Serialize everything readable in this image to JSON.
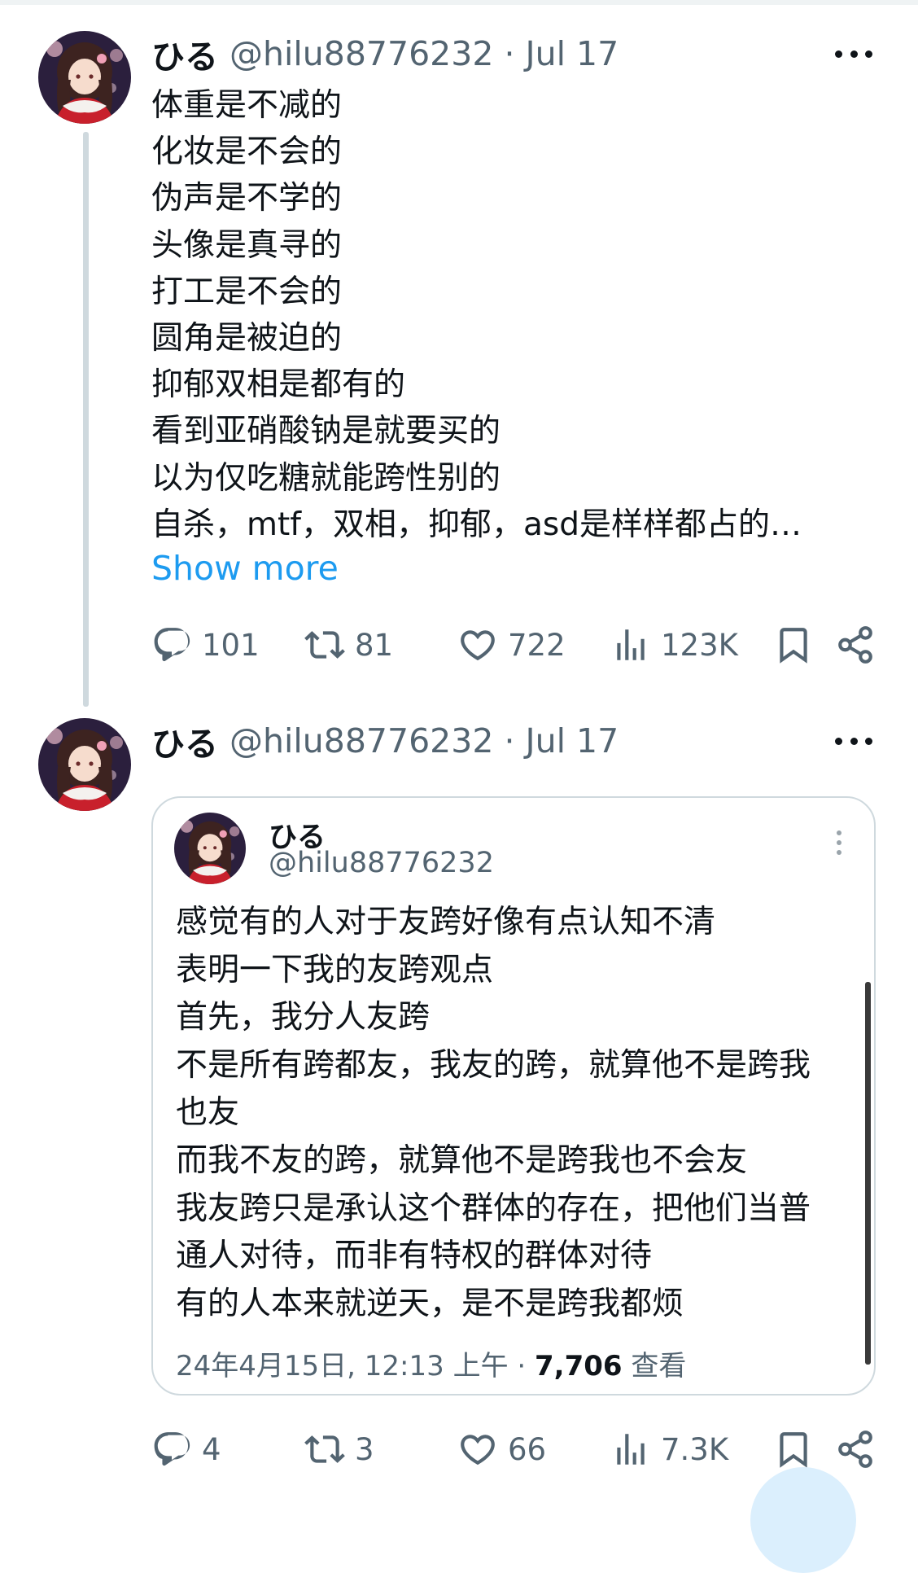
{
  "colors": {
    "accent": "#1d9bf0",
    "text": "#0f1419",
    "muted": "#536471"
  },
  "tweet1": {
    "name": "ひる",
    "handle": "@hilu88776232 · Jul 17",
    "lines": [
      "体重是不减的",
      "化妆是不会的",
      "伪声是不学的",
      "头像是真寻的",
      "打工是不会的",
      "圆角是被迫的",
      "抑郁双相是都有的",
      "看到亚硝酸钠是就要买的",
      "以为仅吃糖就能跨性别的",
      "自杀，mtf，双相，抑郁，asd是样样都占的…"
    ],
    "show_more": "Show more",
    "stats": {
      "replies": "101",
      "reposts": "81",
      "likes": "722",
      "views": "123K"
    }
  },
  "tweet2": {
    "name": "ひる",
    "handle": "@hilu88776232 · Jul 17",
    "quote": {
      "name": "ひる",
      "handle": "@hilu88776232",
      "lines": [
        "感觉有的人对于友跨好像有点认知不清",
        "表明一下我的友跨观点",
        "首先，我分人友跨",
        "不是所有跨都友，我友的跨，就算他不是跨我",
        "也友",
        "而我不友的跨，就算他不是跨我也不会友",
        "我友跨只是承认这个群体的存在，把他们当普",
        "通人对待，而非有特权的群体对待",
        "有的人本来就逆天，是不是跨我都烦"
      ],
      "meta_date": "24年4月15日, 12:13 上午 · ",
      "meta_views": "7,706",
      "meta_views_label": " 查看"
    },
    "stats": {
      "replies": "4",
      "reposts": "3",
      "likes": "66",
      "views": "7.3K"
    }
  },
  "icons": [
    "reply-icon",
    "repost-icon",
    "like-icon",
    "views-icon",
    "bookmark-icon",
    "share-icon",
    "more-icon"
  ]
}
